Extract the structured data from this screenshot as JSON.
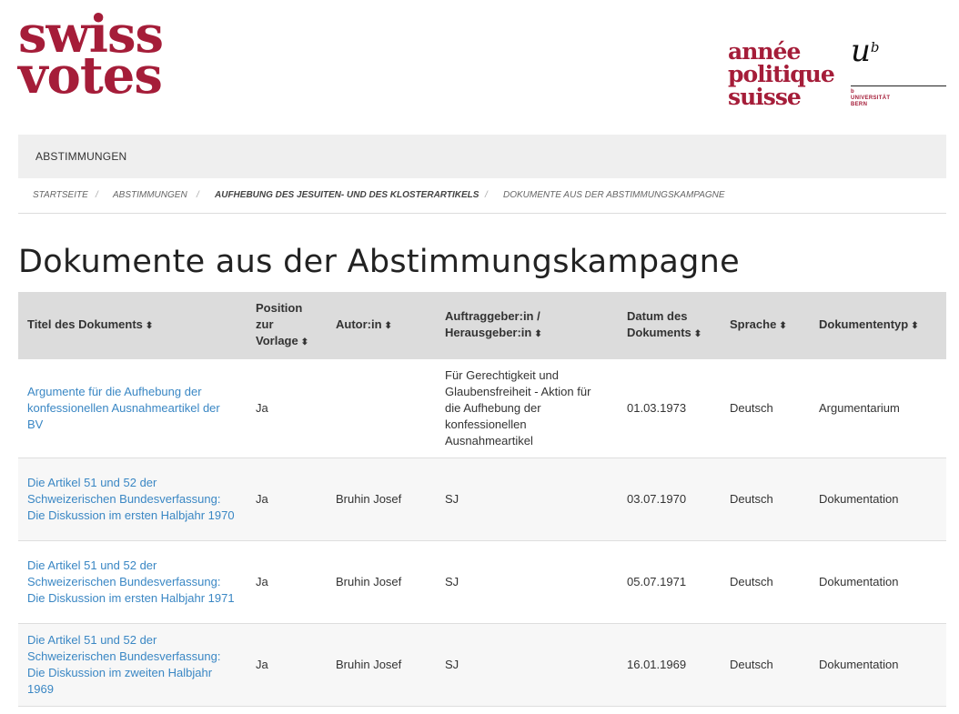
{
  "logos": {
    "swissvotes_line1": "swiss",
    "swissvotes_line2": "votes",
    "aps_line1": "année",
    "aps_line2": "politique",
    "aps_line3": "suisse",
    "unibe_mark": "u",
    "unibe_sup": "b",
    "unibe_line1": "b",
    "unibe_line2": "UNIVERSITÄT",
    "unibe_line3": "BERN"
  },
  "nav": {
    "item": "ABSTIMMUNGEN"
  },
  "breadcrumb": {
    "home": "STARTSEITE",
    "votes": "ABSTIMMUNGEN",
    "vote": "AUFHEBUNG DES JESUITEN- UND DES KLOSTERARTIKELS",
    "current": "DOKUMENTE AUS DER ABSTIMMUNGSKAMPAGNE",
    "separator": "/"
  },
  "page": {
    "title": "Dokumente aus der Abstimmungskampagne"
  },
  "table": {
    "headers": {
      "title": "Titel des Dokuments",
      "position_1": "Position",
      "position_2": "zur",
      "position_3": "Vorlage",
      "author": "Autor:in",
      "client_1": "Auftraggeber:in /",
      "client_2": "Herausgeber:in",
      "date_1": "Datum des",
      "date_2": "Dokuments",
      "language": "Sprache",
      "type": "Dokumententyp",
      "sort_icon": "⬍"
    },
    "rows": [
      {
        "title": "Argumente für die Aufhebung der konfessionellen Ausnahmeartikel der BV",
        "position": "Ja",
        "author": "",
        "client": "Für Gerechtigkeit und Glaubensfreiheit - Aktion für die Aufhebung der konfessionellen Ausnahmeartikel",
        "date": "01.03.1973",
        "language": "Deutsch",
        "type": "Argumentarium"
      },
      {
        "title": "Die Artikel 51 und 52 der Schweizerischen Bundesverfassung: Die Diskussion im ersten Halbjahr 1970",
        "position": "Ja",
        "author": "Bruhin Josef",
        "client": "SJ",
        "date": "03.07.1970",
        "language": "Deutsch",
        "type": "Dokumentation"
      },
      {
        "title": "Die Artikel 51 und 52 der Schweizerischen Bundesverfassung: Die Diskussion im ersten Halbjahr 1971",
        "position": "Ja",
        "author": "Bruhin Josef",
        "client": "SJ",
        "date": "05.07.1971",
        "language": "Deutsch",
        "type": "Dokumentation"
      },
      {
        "title": "Die Artikel 51 und 52 der Schweizerischen Bundesverfassung: Die Diskussion im zweiten Halbjahr 1969",
        "position": "Ja",
        "author": "Bruhin Josef",
        "client": "SJ",
        "date": "16.01.1969",
        "language": "Deutsch",
        "type": "Dokumentation"
      }
    ]
  },
  "colors": {
    "brand": "#a51d39",
    "link": "#3a87c4",
    "header_bg": "#dcdcdc",
    "nav_bg": "#efefef"
  }
}
